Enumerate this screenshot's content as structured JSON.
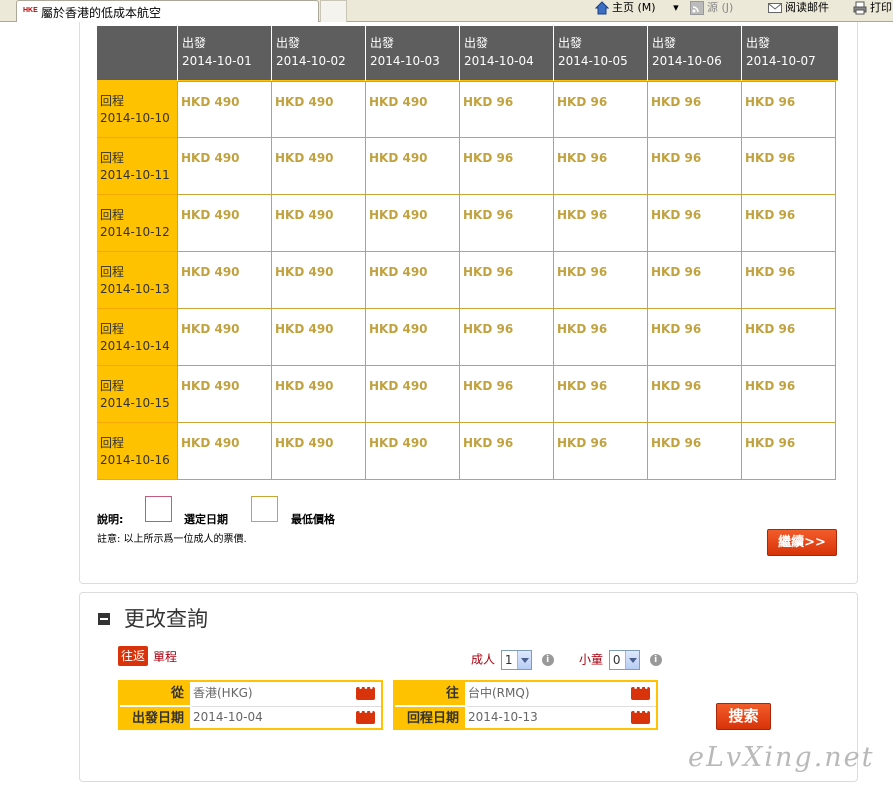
{
  "browser": {
    "tab_title": "屬於香港的低成本航空",
    "tab_logo": "HKE",
    "home_label": "主页 (M)",
    "feed_label": "源 (J)",
    "mail_label": "阅读邮件",
    "print_label": "打印"
  },
  "grid": {
    "header_prefix": "出發",
    "departures": [
      "2014-10-01",
      "2014-10-02",
      "2014-10-03",
      "2014-10-04",
      "2014-10-05",
      "2014-10-06",
      "2014-10-07"
    ],
    "return_prefix": "回程",
    "rows": [
      {
        "date": "2014-10-10",
        "prices": [
          "HKD 490",
          "HKD 490",
          "HKD 490",
          "HKD 96",
          "HKD 96",
          "HKD 96",
          "HKD 96"
        ]
      },
      {
        "date": "2014-10-11",
        "prices": [
          "HKD 490",
          "HKD 490",
          "HKD 490",
          "HKD 96",
          "HKD 96",
          "HKD 96",
          "HKD 96"
        ]
      },
      {
        "date": "2014-10-12",
        "prices": [
          "HKD 490",
          "HKD 490",
          "HKD 490",
          "HKD 96",
          "HKD 96",
          "HKD 96",
          "HKD 96"
        ]
      },
      {
        "date": "2014-10-13",
        "prices": [
          "HKD 490",
          "HKD 490",
          "HKD 490",
          "HKD 96",
          "HKD 96",
          "HKD 96",
          "HKD 96"
        ]
      },
      {
        "date": "2014-10-14",
        "prices": [
          "HKD 490",
          "HKD 490",
          "HKD 490",
          "HKD 96",
          "HKD 96",
          "HKD 96",
          "HKD 96"
        ]
      },
      {
        "date": "2014-10-15",
        "prices": [
          "HKD 490",
          "HKD 490",
          "HKD 490",
          "HKD 96",
          "HKD 96",
          "HKD 96",
          "HKD 96"
        ]
      },
      {
        "date": "2014-10-16",
        "prices": [
          "HKD 490",
          "HKD 490",
          "HKD 490",
          "HKD 96",
          "HKD 96",
          "HKD 96",
          "HKD 96"
        ]
      }
    ],
    "price_color": "#c1a23f",
    "header_bg": "#5e5e5e",
    "accent": "#ffc200"
  },
  "legend": {
    "label": "說明:",
    "selected_label": "選定日期",
    "lowest_label": "最低價格",
    "note": "註意: 以上所示爲一位成人的票價."
  },
  "continue_button": "繼續>>",
  "modify": {
    "title": "更改查詢",
    "round_trip": "往返",
    "one_way": "單程",
    "adult_label": "成人",
    "adult_value": "1",
    "child_label": "小童",
    "child_value": "0",
    "from_label": "從",
    "from_value": "香港(HKG)",
    "depart_label": "出發日期",
    "depart_value": "2014-10-04",
    "to_label": "往",
    "to_value": "台中(RMQ)",
    "return_label": "回程日期",
    "return_value": "2014-10-13",
    "search_button": "搜索"
  },
  "watermark": "eLvXing.net"
}
